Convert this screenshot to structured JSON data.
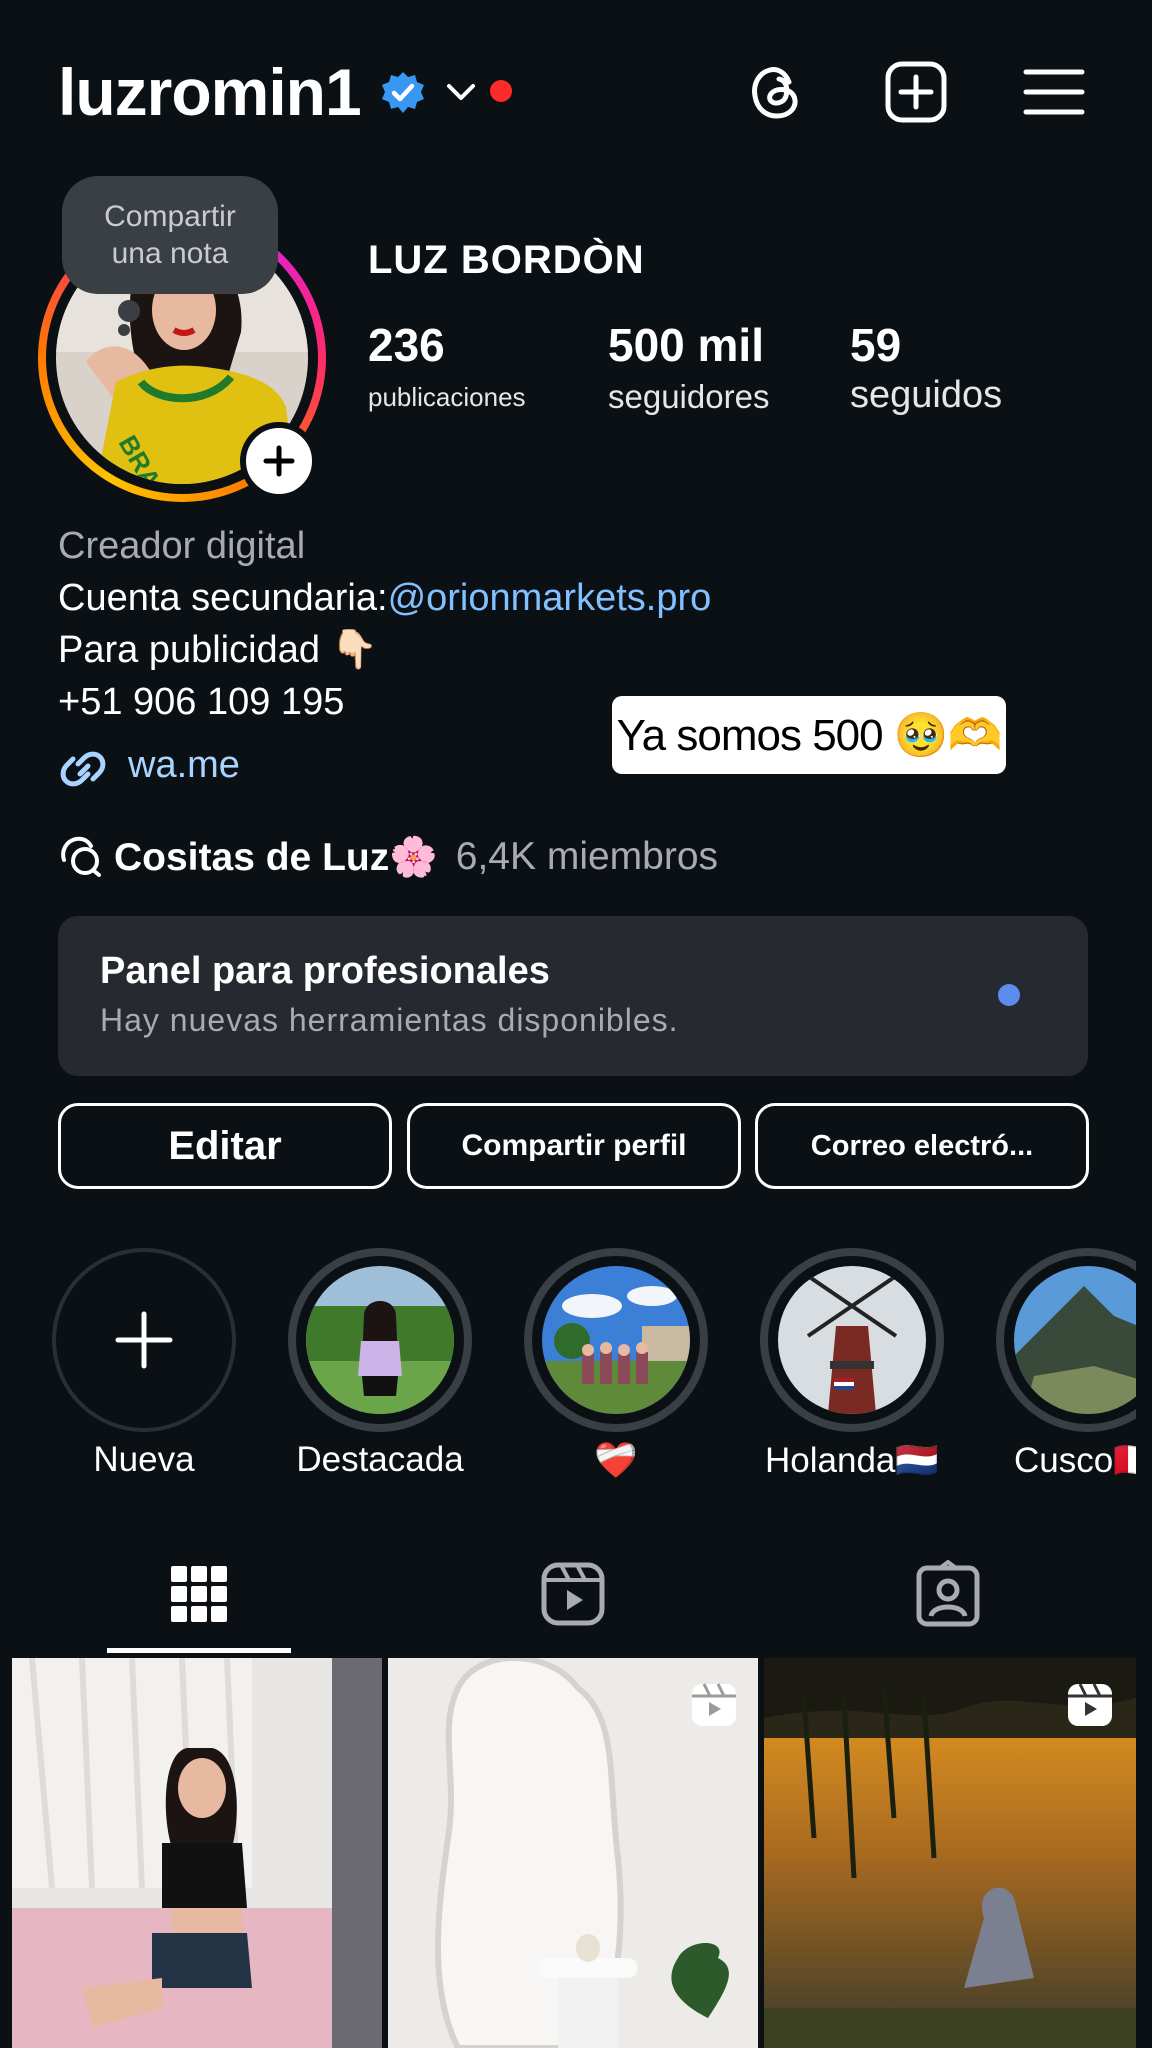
{
  "header": {
    "username": "luzromin1",
    "icons": [
      "verified-badge-icon",
      "chevron-down-icon",
      "threads-icon",
      "add-post-icon",
      "menu-icon"
    ]
  },
  "profile": {
    "note_line1": "Compartir",
    "note_line2": "una nota",
    "full_name": "LUZ BORDÒN",
    "stats": [
      {
        "value": "236",
        "label": "publicaciones"
      },
      {
        "value": "500 mil",
        "label": "seguidores"
      },
      {
        "value": "59",
        "label": "seguidos"
      }
    ]
  },
  "bio": {
    "category": "Creador digital",
    "line1_prefix": "Cuenta secundaria:",
    "line1_mention": "@orionmarkets.pro",
    "line2": "Para publicidad 👇🏻",
    "line3": "+51 906 109 195",
    "link": "wa.me"
  },
  "sticker": "Ya somos 500 🥹🫶",
  "channel": {
    "name": "Cositas de Luz🌸",
    "members": "6,4K miembros"
  },
  "panel": {
    "title": "Panel para profesionales",
    "subtitle": "Hay nuevas herramientas disponibles."
  },
  "buttons": {
    "edit": "Editar",
    "share": "Compartir perfil",
    "email": "Correo electró..."
  },
  "highlights": [
    {
      "label": "Nueva"
    },
    {
      "label": "Destacada"
    },
    {
      "label": "❤️‍🩹"
    },
    {
      "label": "Holanda🇳🇱"
    },
    {
      "label": "Cusco🇵🇪"
    }
  ],
  "colors": {
    "background": "#0b1014",
    "verified": "#3897f0",
    "link": "#83c0ff",
    "panel_bg": "#262a30",
    "panel_dot": "#5b8def",
    "live_dot": "#ff2a2a"
  }
}
